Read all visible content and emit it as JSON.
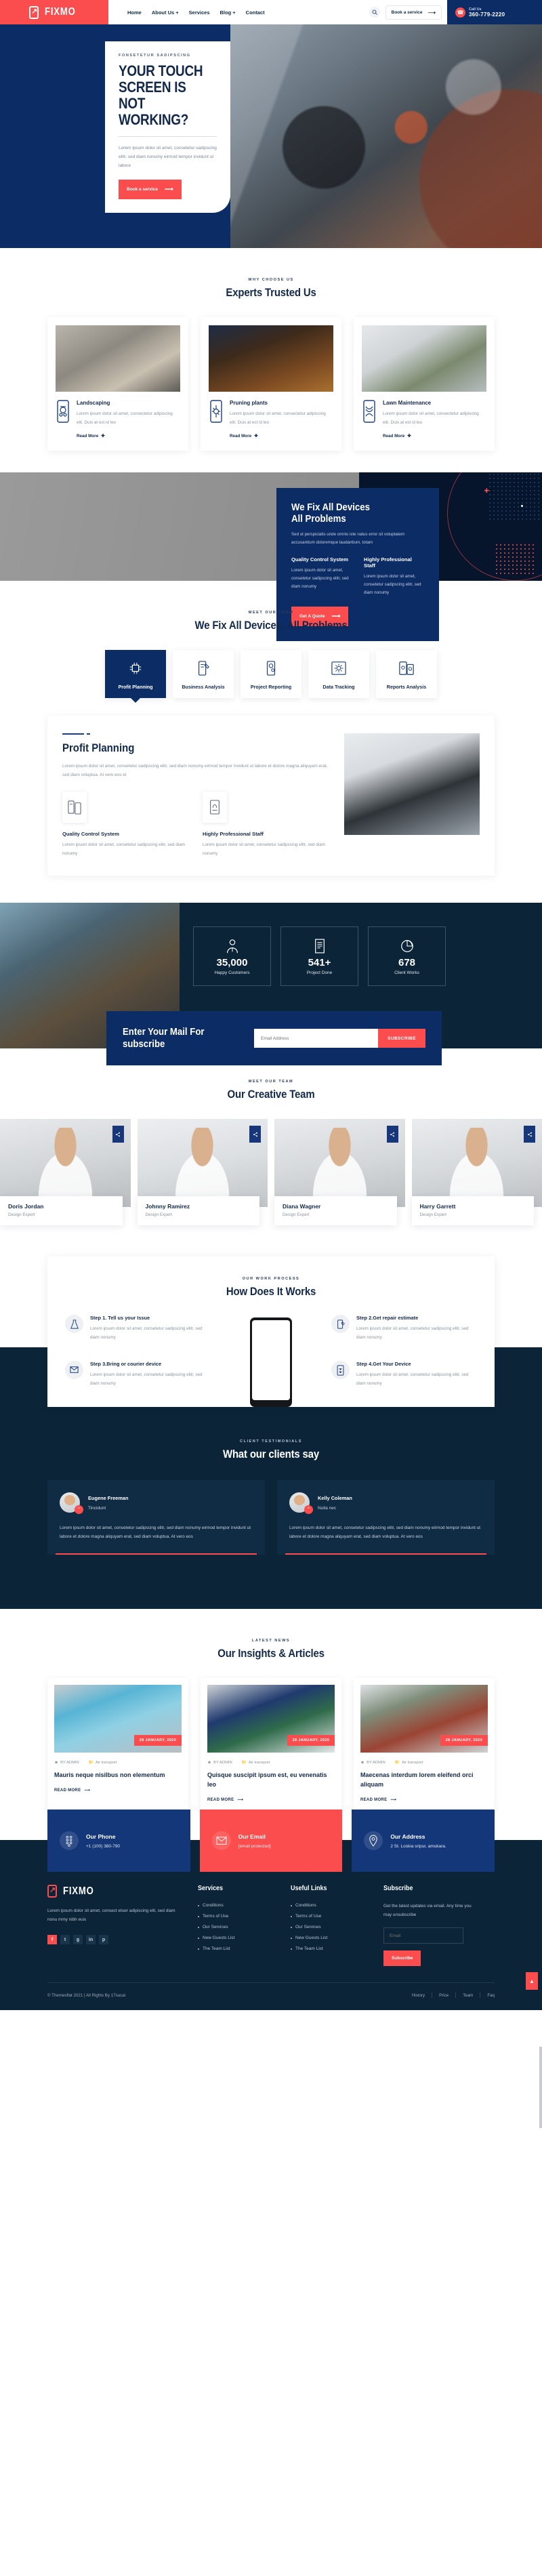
{
  "brand": {
    "name": "FIXMO",
    "accent_red": "#fb4d4d",
    "accent_navy": "#0c2c66",
    "dark": "#0c2438"
  },
  "header": {
    "nav": [
      {
        "label": "Home"
      },
      {
        "label": "About Us +"
      },
      {
        "label": "Services"
      },
      {
        "label": "Blog +"
      },
      {
        "label": "Contact"
      }
    ],
    "search_icon": "search-icon",
    "book_button": "Book a service",
    "call": {
      "label": "Call Us",
      "number": "360-779-2220"
    }
  },
  "hero": {
    "eyebrow": "FONSETETUR SADIPSCING",
    "title_line1": "YOUR TOUCH SCREEN IS",
    "title_line2": "NOT WORKING?",
    "paragraph": "Lorem ipsum dolor sit amet, consetetur sadipscing elitr, sed diam nonumy eirmod tempor invidunt ut labore",
    "cta": "Book a service"
  },
  "why_choose": {
    "eyebrow": "WHY CHOOSE US",
    "title": "Experts Trusted Us",
    "cards": [
      {
        "icon": "phone-repair-icon",
        "title": "Landscaping",
        "text": "Lorem ipsum dolor sit amet, consectetur adipiscing elit. Duis at est id leo",
        "link": "Read More"
      },
      {
        "icon": "phone-bug-icon",
        "title": "Pruning plants",
        "text": "Lorem ipsum dolor sit amet, consectetur adipiscing elit. Duis at est id leo",
        "link": "Read More"
      },
      {
        "icon": "phone-circuit-icon",
        "title": "Lawn Maintenance",
        "text": "Lorem ipsum dolor sit amet, consectetur adipiscing elit. Duis at est id leo",
        "link": "Read More"
      }
    ]
  },
  "fix_banner": {
    "title_line1": "We Fix All Devices",
    "title_line2": "All Problems",
    "paragraph": "Sed ut perspiciatis unde omnis iste natus error sit voluptatem accusantium doloremque laudantium, totam",
    "features": [
      {
        "title": "Quality Control System",
        "text": "Lorem ipsum dolor sit amet, consetetur sadipscing elitr, sed diam nonumy"
      },
      {
        "title": "Highly Professional Staff",
        "text": "Lorem ipsum dolor sit amet, consetetur sadipscing elitr, sed diam nonumy"
      }
    ],
    "cta": "Get A Quote"
  },
  "tabs_section": {
    "eyebrow": "MEET OUR TEAM",
    "title": "We Fix All Devices, All Problems",
    "tabs": [
      {
        "label": "Profit Planning",
        "icon": "chip-hand-icon",
        "active": true
      },
      {
        "label": "Business Analysis",
        "icon": "phone-tool-icon",
        "active": false
      },
      {
        "label": "Project Reporting",
        "icon": "phone-gear-icon",
        "active": false
      },
      {
        "label": "Data Tracking",
        "icon": "screen-burst-icon",
        "active": false
      },
      {
        "label": "Reports Analysis",
        "icon": "devices-sync-icon",
        "active": false
      }
    ],
    "panel": {
      "title": "Profit Planning",
      "paragraph": "Lorem ipsum dolor sit amet, consetetur sadipscing elitr, sed diam nonumy eirmod tempor invidunt ut labore et dolore magna aliquyam erat, sed diam voluptua. At vero eos et",
      "features": [
        {
          "icon": "two-phones-icon",
          "title": "Quality Control System",
          "text": "Lorem ipsum dolor sit amet, consetetur sadipscing elitr, sed diam nonumy"
        },
        {
          "icon": "phone-hands-icon",
          "title": "Highly Professional Staff",
          "text": "Lorem ipsum doior sit amet, consetetur sadipscing elitr, sed diam nonumy"
        }
      ]
    }
  },
  "counters": [
    {
      "icon": "customer-icon",
      "number": "35,000",
      "label": "Happy Customers"
    },
    {
      "icon": "document-icon",
      "number": "541+",
      "label": "Project Done"
    },
    {
      "icon": "pie-chart-icon",
      "number": "678",
      "label": "Client Works"
    }
  ],
  "newsletter": {
    "title_line1": "Enter Your Mail For",
    "title_line2": "subscribe",
    "placeholder": "Email Address",
    "button": "SUBSCRIBE"
  },
  "team": {
    "eyebrow": "MEET OUR TEAM",
    "title": "Our Creative Team",
    "members": [
      {
        "name": "Doris Jordan",
        "role": "Design Expert",
        "share_icon": "share-icon"
      },
      {
        "name": "Johnny Ramirez",
        "role": "Design Expert",
        "share_icon": "share-icon"
      },
      {
        "name": "Diana Wagner",
        "role": "Design Expert",
        "share_icon": "share-icon"
      },
      {
        "name": "Harry Garrett",
        "role": "Design Expert",
        "share_icon": "share-icon"
      }
    ]
  },
  "how_works": {
    "eyebrow": "OUR WORK PROCESS",
    "title": "How Does It Works",
    "steps_left": [
      {
        "icon": "tell-issue-icon",
        "title": "Step 1. Tell us your Issue",
        "text": "Lorem ipsum dolor sit amet, consetetur sadipscing elitr, sed diam nonumy"
      },
      {
        "icon": "courier-icon",
        "title": "Step 3.Bring or courier device",
        "text": "Lorem ipsum dolor sit amet, consetetur sadipscing elitr, sed diam nonumy"
      }
    ],
    "steps_right": [
      {
        "icon": "estimate-icon",
        "title": "Step 2.Get repair estimate",
        "text": "Lorem ipsum dolor sit amet, consetetur sadipscing elitr, sed diam nonumy"
      },
      {
        "icon": "get-device-icon",
        "title": "Step 4.Get Your Device",
        "text": "Lorem ipsum dolor sit amet, consetetur sadipscing elitr, sed diam nonumy"
      }
    ]
  },
  "testimonials": {
    "eyebrow": "CLIENT TESTIMONIALS",
    "title": "What our clients say",
    "items": [
      {
        "name": "Eugene Freeman",
        "role": "Tincidunt",
        "text": "Lorem ipsum dolor sit amet, consetetur sadipscing elitr, sed diam nonumy eirmod tempor invidunt ut labore et dolore magna aliquyam erat, sed diam voluptua. At vero eos"
      },
      {
        "name": "Kelly Coleman",
        "role": "Nulla nec",
        "text": "Lorem ipsum dolor sit amet, consetetur sadipscing elitr, sed diam nonumy eirmod tempor invidunt ut labore et dolore magna aliquyam erat, sed diam voluptua. At vero eos"
      }
    ]
  },
  "blog": {
    "eyebrow": "LATEST NEWS",
    "title": "Our Insights & Articles",
    "posts": [
      {
        "date": "28 JANUARY, 2020",
        "author": "BY ADMIN",
        "category": "Air transport",
        "title": "Mauris neque nisilbus non elementum",
        "link": "READ MORE"
      },
      {
        "date": "28 JANUARY, 2020",
        "author": "BY ADMIN",
        "category": "Air transport",
        "title": "Quisque suscipit ipsum est, eu venenatis leo",
        "link": "READ MORE"
      },
      {
        "date": "28 JANUARY, 2020",
        "author": "BY ADMIN",
        "category": "Air transport",
        "title": "Maecenas interdum lorem eleifend orci aliquam",
        "link": "READ MORE"
      }
    ]
  },
  "contact_cards": [
    {
      "icon": "phone-icon",
      "title": "Our Phone",
      "value": "+1 (100) 380-790"
    },
    {
      "icon": "mail-icon",
      "title": "Our Email",
      "value": "[email protected]"
    },
    {
      "icon": "location-icon",
      "title": "Our Address",
      "value": "2 St. Loskia sripur, amukara."
    }
  ],
  "footer": {
    "about": "Lorem ipsum dolor sit amet, consect etuer adipiscing elit, sed diam nonu mmy nibh euis",
    "socials": [
      "f",
      "t",
      "g",
      "in",
      "p"
    ],
    "columns": [
      {
        "heading": "Services",
        "links": [
          "Conditions",
          "Terms of Use",
          "Our Services",
          "New Guests List",
          "The Team List"
        ]
      },
      {
        "heading": "Useful Links",
        "links": [
          "Conditions",
          "Terms of Use",
          "Our Services",
          "New Guests List",
          "The Team List"
        ]
      }
    ],
    "subscribe": {
      "heading": "Subscribe",
      "text": "Get the latest updates via email. Any time you may unsubscribe",
      "placeholder": "Email",
      "button": "Subscribe"
    },
    "copyright": "© Themesflat  2021 | All Rights By 17sucai",
    "bottom_links": [
      "History",
      "Price",
      "Team",
      "Faq"
    ],
    "to_top_icon": "chevron-up-icon"
  }
}
